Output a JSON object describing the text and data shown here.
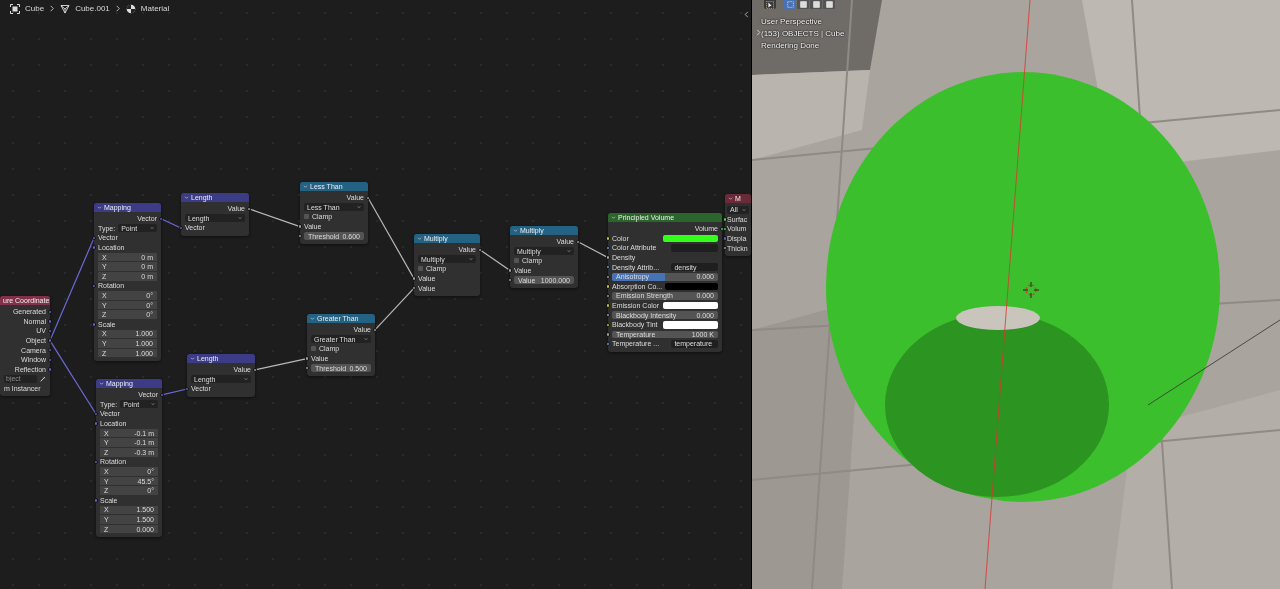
{
  "breadcrumbs": [
    {
      "label": "Cube",
      "kind": "object"
    },
    {
      "label": "Cube.001",
      "kind": "mesh"
    },
    {
      "label": "Material",
      "kind": "material"
    }
  ],
  "nodes": [
    {
      "title": "ure Coordinate",
      "kind": "input",
      "rows": [
        {
          "kind": "output",
          "label": "Generated",
          "socket": {
            "kind": "vector"
          }
        },
        {
          "kind": "output",
          "label": "Normal",
          "socket": {
            "kind": "vector"
          }
        },
        {
          "kind": "output",
          "label": "UV",
          "socket": {
            "kind": "vector"
          }
        },
        {
          "kind": "output",
          "label": "Object",
          "socket": {
            "kind": "vector"
          }
        },
        {
          "kind": "output",
          "label": "Camera",
          "socket": {
            "kind": "vector"
          }
        },
        {
          "kind": "output",
          "label": "Window",
          "socket": {
            "kind": "vector"
          }
        },
        {
          "kind": "output",
          "label": "Reflection",
          "socket": {
            "kind": "vector"
          }
        },
        {
          "kind": "object_field",
          "placeholder": "bject"
        },
        {
          "kind": "text",
          "label": "m Instancer"
        }
      ]
    },
    {
      "title": "Mapping",
      "kind": "vector",
      "rows": [
        {
          "kind": "output",
          "label": "Vector",
          "socket": {
            "kind": "vector"
          }
        },
        {
          "kind": "dropdown",
          "label": "Type:",
          "value": "Point"
        },
        {
          "kind": "input",
          "label": "Vector",
          "socket": {
            "kind": "vector"
          }
        },
        {
          "kind": "input",
          "label": "Location",
          "socket": {
            "kind": "vector"
          }
        },
        {
          "kind": "axis",
          "label": "X",
          "value": "0 m"
        },
        {
          "kind": "axis",
          "label": "Y",
          "value": "0 m"
        },
        {
          "kind": "axis",
          "label": "Z",
          "value": "0 m"
        },
        {
          "kind": "input",
          "label": "Rotation",
          "socket": {
            "kind": "vector"
          }
        },
        {
          "kind": "axis",
          "label": "X",
          "value": "0°"
        },
        {
          "kind": "axis",
          "label": "Y",
          "value": "0°"
        },
        {
          "kind": "axis",
          "label": "Z",
          "value": "0°"
        },
        {
          "kind": "input",
          "label": "Scale",
          "socket": {
            "kind": "vector"
          }
        },
        {
          "kind": "axis",
          "label": "X",
          "value": "1.000"
        },
        {
          "kind": "axis",
          "label": "Y",
          "value": "1.000"
        },
        {
          "kind": "axis",
          "label": "Z",
          "value": "1.000"
        }
      ]
    },
    {
      "title": "Length",
      "kind": "vector",
      "rows": [
        {
          "kind": "output",
          "label": "Value",
          "socket": {
            "kind": "float"
          }
        },
        {
          "kind": "dropdown",
          "value": "Length"
        },
        {
          "kind": "input",
          "label": "Vector",
          "socket": {
            "kind": "vector"
          }
        }
      ]
    },
    {
      "title": "Less Than",
      "kind": "converter",
      "rows": [
        {
          "kind": "output",
          "label": "Value",
          "socket": {
            "kind": "float"
          }
        },
        {
          "kind": "dropdown",
          "value": "Less Than"
        },
        {
          "kind": "checkbox",
          "label": "Clamp",
          "checked": false
        },
        {
          "kind": "input",
          "label": "Value",
          "socket": {
            "kind": "float"
          }
        },
        {
          "kind": "field",
          "label": "Threshold",
          "value": "0.600",
          "socket": {
            "kind": "float"
          }
        }
      ]
    },
    {
      "title": "Mapping",
      "kind": "vector",
      "rows": [
        {
          "kind": "output",
          "label": "Vector",
          "socket": {
            "kind": "vector"
          }
        },
        {
          "kind": "dropdown",
          "label": "Type:",
          "value": "Point"
        },
        {
          "kind": "input",
          "label": "Vector",
          "socket": {
            "kind": "vector"
          }
        },
        {
          "kind": "input",
          "label": "Location",
          "socket": {
            "kind": "vector"
          }
        },
        {
          "kind": "axis",
          "label": "X",
          "value": "-0.1 m"
        },
        {
          "kind": "axis",
          "label": "Y",
          "value": "-0.1 m"
        },
        {
          "kind": "axis",
          "label": "Z",
          "value": "-0.3 m"
        },
        {
          "kind": "input",
          "label": "Rotation",
          "socket": {
            "kind": "vector"
          }
        },
        {
          "kind": "axis",
          "label": "X",
          "value": "0°"
        },
        {
          "kind": "axis",
          "label": "Y",
          "value": "45.5°"
        },
        {
          "kind": "axis",
          "label": "Z",
          "value": "0°"
        },
        {
          "kind": "input",
          "label": "Scale",
          "socket": {
            "kind": "vector"
          }
        },
        {
          "kind": "axis",
          "label": "X",
          "value": "1.500"
        },
        {
          "kind": "axis",
          "label": "Y",
          "value": "1.500"
        },
        {
          "kind": "axis",
          "label": "Z",
          "value": "0.000"
        }
      ]
    },
    {
      "title": "Length",
      "kind": "vector",
      "rows": [
        {
          "kind": "output",
          "label": "Value",
          "socket": {
            "kind": "float"
          }
        },
        {
          "kind": "dropdown",
          "value": "Length"
        },
        {
          "kind": "input",
          "label": "Vector",
          "socket": {
            "kind": "vector"
          }
        }
      ]
    },
    {
      "title": "Greater Than",
      "kind": "converter",
      "rows": [
        {
          "kind": "output",
          "label": "Value",
          "socket": {
            "kind": "float"
          }
        },
        {
          "kind": "dropdown",
          "value": "Greater Than"
        },
        {
          "kind": "checkbox",
          "label": "Clamp",
          "checked": false
        },
        {
          "kind": "input",
          "label": "Value",
          "socket": {
            "kind": "float"
          }
        },
        {
          "kind": "field",
          "label": "Threshold",
          "value": "0.500",
          "socket": {
            "kind": "float"
          }
        }
      ]
    },
    {
      "title": "Multiply",
      "kind": "converter",
      "rows": [
        {
          "kind": "output",
          "label": "Value",
          "socket": {
            "kind": "float"
          }
        },
        {
          "kind": "dropdown",
          "value": "Multiply"
        },
        {
          "kind": "checkbox",
          "label": "Clamp",
          "checked": false
        },
        {
          "kind": "input",
          "label": "Value",
          "socket": {
            "kind": "float"
          }
        },
        {
          "kind": "input",
          "label": "Value",
          "socket": {
            "kind": "float"
          }
        }
      ]
    },
    {
      "title": "Multiply",
      "kind": "converter",
      "rows": [
        {
          "kind": "output",
          "label": "Value",
          "socket": {
            "kind": "float"
          }
        },
        {
          "kind": "dropdown",
          "value": "Multiply"
        },
        {
          "kind": "checkbox",
          "label": "Clamp",
          "checked": false
        },
        {
          "kind": "input",
          "label": "Value",
          "socket": {
            "kind": "float"
          }
        },
        {
          "kind": "field",
          "label": "Value",
          "value": "1000.000",
          "socket": {
            "kind": "float"
          }
        }
      ]
    },
    {
      "title": "Principled Volume",
      "kind": "shader",
      "rows": [
        {
          "kind": "output",
          "label": "Volume",
          "socket": {
            "kind": "shader"
          }
        },
        {
          "kind": "swatch",
          "label": "Color",
          "color": "#33ff1a",
          "socket": {
            "kind": "color"
          }
        },
        {
          "kind": "text_field",
          "label": "Color Attribute",
          "socket": {
            "kind": "attribute"
          }
        },
        {
          "kind": "input",
          "label": "Density",
          "socket": {
            "kind": "float"
          }
        },
        {
          "kind": "text_field",
          "label": "Density Attrib...",
          "value": "density",
          "socket": {
            "kind": "attribute"
          }
        },
        {
          "kind": "slider",
          "label": "Anisotropy",
          "value": "0.000",
          "level": 0.5,
          "socket": {
            "kind": "float"
          }
        },
        {
          "kind": "swatch",
          "label": "Absorption Co...",
          "color": "#000000",
          "socket": {
            "kind": "color"
          }
        },
        {
          "kind": "field",
          "label": "Emission Strength",
          "value": "0.000",
          "socket": {
            "kind": "float"
          }
        },
        {
          "kind": "swatch",
          "label": "Emission Color",
          "color": "#ffffff",
          "socket": {
            "kind": "color"
          }
        },
        {
          "kind": "field",
          "label": "Blackbody Intensity",
          "value": "0.000",
          "socket": {
            "kind": "float"
          }
        },
        {
          "kind": "swatch",
          "label": "Blackbody Tint",
          "color": "#ffffff",
          "socket": {
            "kind": "color"
          }
        },
        {
          "kind": "field",
          "label": "Temperature",
          "value": "1000 K",
          "socket": {
            "kind": "float"
          }
        },
        {
          "kind": "text_field",
          "label": "Temperature ...",
          "value": "temperature",
          "socket": {
            "kind": "attribute"
          }
        }
      ]
    },
    {
      "title": "M",
      "kind": "output",
      "rows": [
        {
          "kind": "dropdown",
          "value": "All"
        },
        {
          "kind": "input",
          "label": "Surfac",
          "socket": {
            "kind": "shader"
          }
        },
        {
          "kind": "input",
          "label": "Volum",
          "socket": {
            "kind": "shader"
          }
        },
        {
          "kind": "input",
          "label": "Displa",
          "socket": {
            "kind": "vector"
          }
        },
        {
          "kind": "input",
          "label": "Thickn",
          "socket": {
            "kind": "float"
          }
        }
      ]
    }
  ],
  "viewport": {
    "select_modes": [
      {
        "selected": true
      },
      {
        "selected": false
      },
      {
        "selected": false
      },
      {
        "selected": false
      }
    ],
    "overlay": [
      "User Perspective",
      "(153) OBJECTS | Cube",
      "Rendering Done"
    ]
  }
}
